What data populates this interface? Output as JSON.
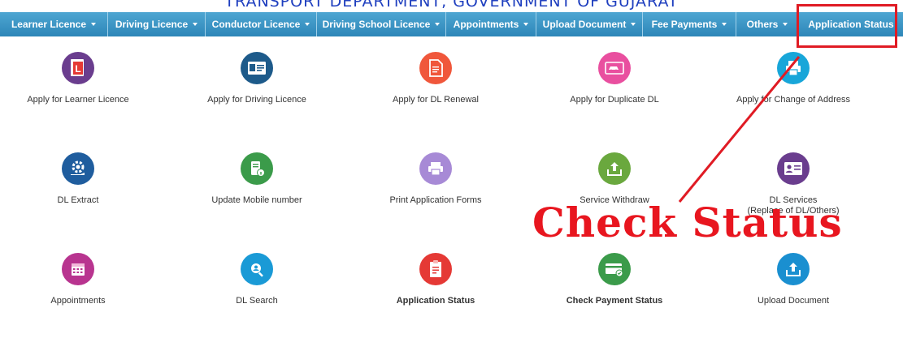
{
  "header": {
    "title": "TRANSPORT DEPARTMENT, GOVERNMENT OF GUJARAT"
  },
  "nav": [
    {
      "label": "Learner Licence",
      "dropdown": true
    },
    {
      "label": "Driving Licence",
      "dropdown": true
    },
    {
      "label": "Conductor Licence",
      "dropdown": true
    },
    {
      "label": "Driving School Licence",
      "dropdown": true
    },
    {
      "label": "Appointments",
      "dropdown": true
    },
    {
      "label": "Upload Document",
      "dropdown": true
    },
    {
      "label": "Fee Payments",
      "dropdown": true
    },
    {
      "label": "Others",
      "dropdown": true
    },
    {
      "label": "Application Status",
      "dropdown": false
    }
  ],
  "tiles": [
    {
      "label": "Apply for Learner Licence",
      "color": "#6a3d8e",
      "icon": "learner-licence-icon"
    },
    {
      "label": "Apply for Driving Licence",
      "color": "#1d5a8a",
      "icon": "driving-licence-icon"
    },
    {
      "label": "Apply for DL Renewal",
      "color": "#f0573b",
      "icon": "document-icon"
    },
    {
      "label": "Apply for Duplicate DL",
      "color": "#e94f9f",
      "icon": "car-card-icon"
    },
    {
      "label": "Apply for Change of Address",
      "color": "#18a6d9",
      "icon": "printer-icon"
    },
    {
      "label": "DL Extract",
      "color": "#1f5d9e",
      "icon": "gear-hand-icon"
    },
    {
      "label": "Update Mobile number",
      "color": "#3b9b4a",
      "icon": "mobile-info-icon"
    },
    {
      "label": "Print Application Forms",
      "color": "#a78ad6",
      "icon": "print-forms-icon"
    },
    {
      "label": "Service Withdraw",
      "color": "#6aa83e",
      "icon": "withdraw-upload-icon"
    },
    {
      "label": "DL Services",
      "sublabel": "(Replace of DL/Others)",
      "color": "#6a3d8e",
      "icon": "id-card-icon"
    },
    {
      "label": "Appointments",
      "color": "#b8348f",
      "icon": "calendar-icon"
    },
    {
      "label": "DL Search",
      "color": "#1a9ad6",
      "icon": "search-user-icon"
    },
    {
      "label": "Application Status",
      "color": "#e53935",
      "icon": "clipboard-icon"
    },
    {
      "label": "Check Payment Status",
      "color": "#3b9b4a",
      "icon": "payment-card-icon"
    },
    {
      "label": "Upload Document",
      "color": "#1a8fd0",
      "icon": "upload-icon"
    }
  ],
  "annotation": {
    "text": "Check Status",
    "color": "#e8161f"
  }
}
